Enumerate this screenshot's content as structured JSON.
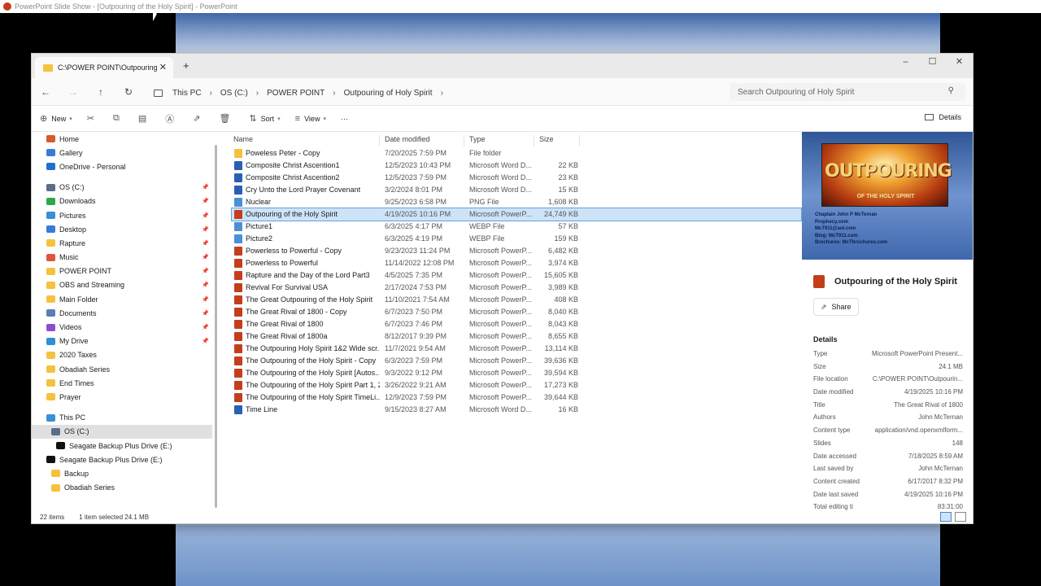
{
  "app_title": "PowerPoint Slide Show - [Outpouring of the Holy Spirit] - PowerPoint",
  "tab": {
    "label": "C:\\POWER POINT\\Outpouring"
  },
  "window_controls": {
    "minimize": "–",
    "maximize": "☐",
    "close": "✕"
  },
  "breadcrumb": [
    "This PC",
    "OS (C:)",
    "POWER POINT",
    "Outpouring of Holy Spirit"
  ],
  "search": {
    "placeholder": "Search Outpouring of Holy Spirit"
  },
  "toolbar": {
    "new": "New",
    "sort": "Sort",
    "view": "View",
    "more": "···",
    "details": "Details"
  },
  "sidebar": {
    "quick": [
      {
        "label": "Home",
        "color": "#d9572b"
      },
      {
        "label": "Gallery",
        "color": "#3a7bd5"
      },
      {
        "label": "OneDrive - Personal",
        "color": "#1f6fd1"
      }
    ],
    "pinned": [
      {
        "label": "OS (C:)",
        "color": "#5a6d8a"
      },
      {
        "label": "Downloads",
        "color": "#2ea84a"
      },
      {
        "label": "Pictures",
        "color": "#3a8fd8"
      },
      {
        "label": "Desktop",
        "color": "#3a7bd5"
      },
      {
        "label": "Rapture",
        "color": "#f5c23e"
      },
      {
        "label": "Music",
        "color": "#e0553a"
      },
      {
        "label": "POWER POINT",
        "color": "#f5c23e"
      },
      {
        "label": "OBS and Streaming",
        "color": "#f5c23e"
      },
      {
        "label": "Main Folder",
        "color": "#f5c23e"
      },
      {
        "label": "Documents",
        "color": "#5a7db5"
      },
      {
        "label": "Videos",
        "color": "#8a4fd0"
      },
      {
        "label": "My Drive",
        "color": "#2e8fd8"
      },
      {
        "label": "2020 Taxes",
        "color": "#f5c23e"
      },
      {
        "label": "Obadiah Series",
        "color": "#f5c23e"
      },
      {
        "label": "End Times",
        "color": "#f5c23e"
      },
      {
        "label": "Prayer",
        "color": "#f5c23e"
      }
    ],
    "tree": [
      {
        "label": "This PC",
        "color": "#3a8fd8",
        "indent": 0
      },
      {
        "label": "OS (C:)",
        "color": "#5a6d8a",
        "indent": 1,
        "selected": true
      },
      {
        "label": "Seagate Backup Plus Drive (E:)",
        "color": "#111111",
        "indent": 2
      },
      {
        "label": "Seagate Backup Plus Drive (E:)",
        "color": "#111111",
        "indent": 0
      },
      {
        "label": "Backup",
        "color": "#f5c23e",
        "indent": 1
      },
      {
        "label": "Obadiah Series",
        "color": "#f5c23e",
        "indent": 1
      }
    ]
  },
  "columns": {
    "name": "Name",
    "date": "Date modified",
    "type": "Type",
    "size": "Size"
  },
  "files": [
    {
      "name": "Poweless Peter - Copy",
      "date": "7/20/2025 7:59 PM",
      "type": "File folder",
      "size": "",
      "kind": "folder"
    },
    {
      "name": "Composite Christ Ascention1",
      "date": "12/5/2023 10:43 PM",
      "type": "Microsoft Word D...",
      "size": "22 KB",
      "kind": "word"
    },
    {
      "name": "Composite Christ Ascention2",
      "date": "12/5/2023 7:59 PM",
      "type": "Microsoft Word D...",
      "size": "23 KB",
      "kind": "word"
    },
    {
      "name": "Cry Unto the Lord Prayer Covenant",
      "date": "3/2/2024 8:01 PM",
      "type": "Microsoft Word D...",
      "size": "15 KB",
      "kind": "word"
    },
    {
      "name": "Nuclear",
      "date": "9/25/2023 6:58 PM",
      "type": "PNG File",
      "size": "1,608 KB",
      "kind": "image"
    },
    {
      "name": "Outpouring of the Holy Spirit",
      "date": "4/19/2025 10:16 PM",
      "type": "Microsoft PowerP...",
      "size": "24,749 KB",
      "kind": "ppt",
      "selected": true
    },
    {
      "name": "Picture1",
      "date": "6/3/2025 4:17 PM",
      "type": "WEBP File",
      "size": "57 KB",
      "kind": "image"
    },
    {
      "name": "Picture2",
      "date": "6/3/2025 4:19 PM",
      "type": "WEBP File",
      "size": "159 KB",
      "kind": "image"
    },
    {
      "name": "Powerless to Powerful - Copy",
      "date": "9/23/2023 11:24 PM",
      "type": "Microsoft PowerP...",
      "size": "6,482 KB",
      "kind": "ppt"
    },
    {
      "name": "Powerless to Powerful",
      "date": "11/14/2022 12:08 PM",
      "type": "Microsoft PowerP...",
      "size": "3,974 KB",
      "kind": "ppt"
    },
    {
      "name": "Rapture and the Day of the Lord Part3",
      "date": "4/5/2025 7:35 PM",
      "type": "Microsoft PowerP...",
      "size": "15,605 KB",
      "kind": "ppt"
    },
    {
      "name": "Revival For Survival USA",
      "date": "2/17/2024 7:53 PM",
      "type": "Microsoft PowerP...",
      "size": "3,989 KB",
      "kind": "ppt"
    },
    {
      "name": "The Great Outpouring of the Holy Spirit",
      "date": "11/10/2021 7:54 AM",
      "type": "Microsoft PowerP...",
      "size": "408 KB",
      "kind": "ppt"
    },
    {
      "name": "The Great Rival of 1800 - Copy",
      "date": "6/7/2023 7:50 PM",
      "type": "Microsoft PowerP...",
      "size": "8,040 KB",
      "kind": "ppt"
    },
    {
      "name": "The Great Rival of 1800",
      "date": "6/7/2023 7:46 PM",
      "type": "Microsoft PowerP...",
      "size": "8,043 KB",
      "kind": "ppt"
    },
    {
      "name": "The Great Rival of 1800a",
      "date": "8/12/2017 9:39 PM",
      "type": "Microsoft PowerP...",
      "size": "8,655 KB",
      "kind": "ppt"
    },
    {
      "name": "The Outpouring Holy Spirit 1&2 Wide scr...",
      "date": "11/7/2021 9:54 AM",
      "type": "Microsoft PowerP...",
      "size": "13,114 KB",
      "kind": "ppt"
    },
    {
      "name": "The Outpouring of the Holy Spirit - Copy",
      "date": "6/3/2023 7:59 PM",
      "type": "Microsoft PowerP...",
      "size": "39,636 KB",
      "kind": "ppt"
    },
    {
      "name": "The Outpouring of the Holy Spirit [Autos...",
      "date": "9/3/2022 9:12 PM",
      "type": "Microsoft PowerP...",
      "size": "39,594 KB",
      "kind": "ppt"
    },
    {
      "name": "The Outpouring of the Holy Spirit Part 1, 2",
      "date": "3/26/2022 9:21 AM",
      "type": "Microsoft PowerP...",
      "size": "17,273 KB",
      "kind": "ppt"
    },
    {
      "name": "The Outpouring of the Holy Spirit TimeLi...",
      "date": "12/9/2023 7:59 PM",
      "type": "Microsoft PowerP...",
      "size": "39,644 KB",
      "kind": "ppt"
    },
    {
      "name": "Time Line",
      "date": "9/15/2023 8:27 AM",
      "type": "Microsoft Word D...",
      "size": "16 KB",
      "kind": "word"
    }
  ],
  "kind_colors": {
    "folder": "#f5c23e",
    "word": "#2b5fb4",
    "ppt": "#c43e1c",
    "image": "#4a8fd8"
  },
  "preview": {
    "thumb_title": "OUTPOURING",
    "thumb_subtitle": "OF THE HOLY SPIRIT",
    "thumb_lines": [
      "Chaplain John P McTernan",
      "Prophecy.com",
      "McT911@aol.com",
      "Blog: McT911.com",
      "Brochures: McTbrochures.com"
    ],
    "title": "Outpouring of the Holy Spirit",
    "share": "Share",
    "details_heading": "Details",
    "props": [
      {
        "k": "Type",
        "v": "Microsoft PowerPoint Present..."
      },
      {
        "k": "Size",
        "v": "24.1 MB"
      },
      {
        "k": "File location",
        "v": "C:\\POWER POINT\\Outpourin..."
      },
      {
        "k": "Date modified",
        "v": "4/19/2025 10:16 PM"
      },
      {
        "k": "Title",
        "v": "The Great Rival of 1800"
      },
      {
        "k": "Authors",
        "v": "John McTernan"
      },
      {
        "k": "Content type",
        "v": "application/vnd.openxmlform..."
      },
      {
        "k": "Slides",
        "v": "148"
      },
      {
        "k": "Date accessed",
        "v": "7/18/2025 8:59 AM"
      },
      {
        "k": "Last saved by",
        "v": "John McTernan"
      },
      {
        "k": "Content created",
        "v": "6/17/2017 8:32 PM"
      },
      {
        "k": "Date last saved",
        "v": "4/19/2025 10:16 PM"
      },
      {
        "k": "Total editing ti",
        "v": "83:31:00"
      }
    ]
  },
  "status": {
    "items": "22 items",
    "selected": "1 item selected  24.1 MB"
  }
}
